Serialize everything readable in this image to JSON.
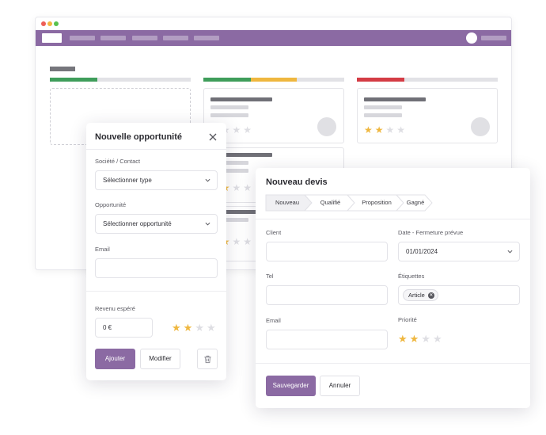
{
  "colors": {
    "accent": "#8b6aa3",
    "green": "#3f9d5b",
    "yellow": "#efb73f",
    "red": "#d43c45",
    "star_on": "#efb73f",
    "star_off": "#dedee3"
  },
  "opportunity_dialog": {
    "title": "Nouvelle opportunité",
    "company_label": "Société / Contact",
    "company_value": "Sélectionner type",
    "opportunity_label": "Opportunité",
    "opportunity_value": "Sélectionner opportunité",
    "email_label": "Email",
    "email_value": "",
    "revenue_label": "Revenu espéré",
    "revenue_value": "0 €",
    "rating": 2,
    "rating_max": 4,
    "add_label": "Ajouter",
    "edit_label": "Modifier"
  },
  "quote_dialog": {
    "title": "Nouveau devis",
    "steps": [
      "Nouveau",
      "Qualifié",
      "Proposition",
      "Gagné"
    ],
    "active_step": "Nouveau",
    "client_label": "Client",
    "client_value": "",
    "close_date_label": "Date - Fermeture prévue",
    "close_date_value": "01/01/2024",
    "tel_label": "Tel",
    "tel_value": "",
    "tags_label": "Étiquettes",
    "tags": [
      "Article"
    ],
    "email_label": "Email",
    "email_value": "",
    "priority_label": "Priorité",
    "priority": 2,
    "priority_max": 4,
    "save_label": "Sauvegarder",
    "cancel_label": "Annuler"
  },
  "icons": [
    "close-icon",
    "chevron-down-icon",
    "trash-icon",
    "star-icon",
    "remove-tag-icon"
  ]
}
